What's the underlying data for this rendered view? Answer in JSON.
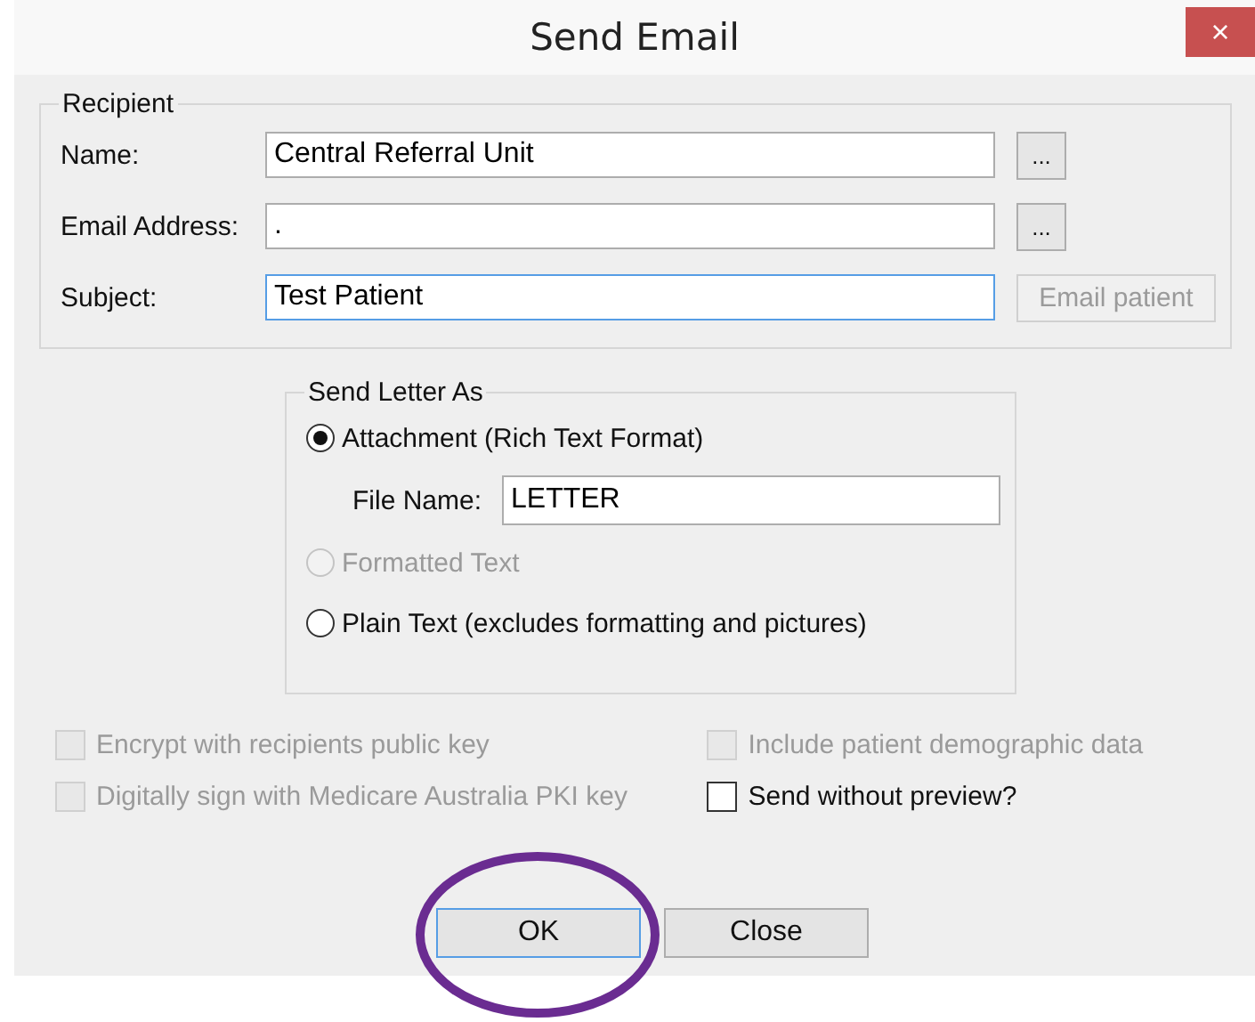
{
  "window": {
    "title": "Send Email",
    "close_icon": "×"
  },
  "recipient": {
    "legend": "Recipient",
    "rows": [
      {
        "label": "Name:",
        "value": "Central Referral Unit",
        "focused": false,
        "button": {
          "label": "...",
          "disabled": false
        }
      },
      {
        "label": "Email Address:",
        "value": ".",
        "focused": false,
        "button": {
          "label": "...",
          "disabled": false
        }
      },
      {
        "label": "Subject:",
        "value": "Test Patient",
        "focused": true,
        "button": {
          "label": "Email patient",
          "disabled": true
        }
      }
    ]
  },
  "send_as": {
    "legend": "Send Letter As",
    "options": [
      {
        "label": "Attachment (Rich Text Format)",
        "selected": true,
        "disabled": false,
        "file_name": {
          "label": "File Name:",
          "value": "LETTER"
        }
      },
      {
        "label": "Formatted Text",
        "selected": false,
        "disabled": true
      },
      {
        "label": "Plain Text (excludes formatting and pictures)",
        "selected": false,
        "disabled": false
      }
    ]
  },
  "checkboxes_left": [
    {
      "label": "Encrypt with recipients public key",
      "checked": false,
      "disabled": true
    },
    {
      "label": "Digitally sign with Medicare Australia PKI key",
      "checked": false,
      "disabled": true
    }
  ],
  "checkboxes_right": [
    {
      "label": "Include patient demographic data",
      "checked": false,
      "disabled": true
    },
    {
      "label": "Send without preview?",
      "checked": false,
      "disabled": false
    }
  ],
  "buttons": [
    {
      "label": "OK",
      "default": true,
      "circled": true
    },
    {
      "label": "Close",
      "default": false,
      "circled": false
    }
  ]
}
